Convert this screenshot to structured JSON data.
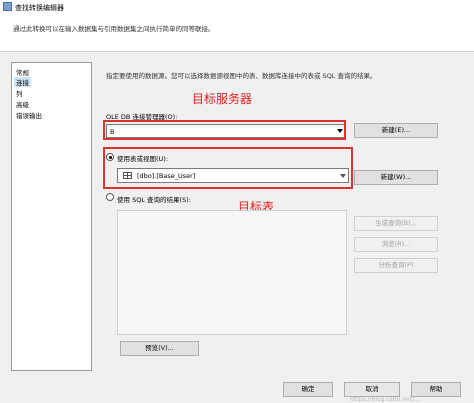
{
  "window": {
    "title": "查找转换编辑器",
    "description": "通过此转换可以在输入数据集与引用数据集之间执行简单的同等联接。"
  },
  "nav": {
    "items": [
      "常规",
      "连接",
      "列",
      "高级",
      "错误输出"
    ],
    "selected_index": 1
  },
  "connection": {
    "section_description": "指定要使用的数据源。您可以选择数据源视图中的表、数据库连接中的表或 SQL 查询的结果。",
    "ole_db_label": "OLE DB 连接管理器(O):",
    "ole_db_value": "B",
    "new_button_1": "新建(E)...",
    "use_table_label": "使用表或视图(U):",
    "table_value": "[dbo].[Base_User]",
    "new_button_2": "新建(W)...",
    "use_sql_label": "使用 SQL 查询的结果(S):",
    "build_query_button": "生成查询(B)...",
    "browse_button": "浏览(R)...",
    "parse_query_button": "分析查询(P)",
    "preview_button": "预览(V)...",
    "use_table_checked": true
  },
  "annotations": {
    "target_server": "目标服务器",
    "target_table": "目标表"
  },
  "footer": {
    "ok_button": "确定",
    "cancel_button": "取消",
    "help_button": "帮助",
    "watermark": "https://blog.csdn.net/..."
  },
  "colors": {
    "annotation_red": "#e02020",
    "selection_blue": "#cce4f7"
  }
}
